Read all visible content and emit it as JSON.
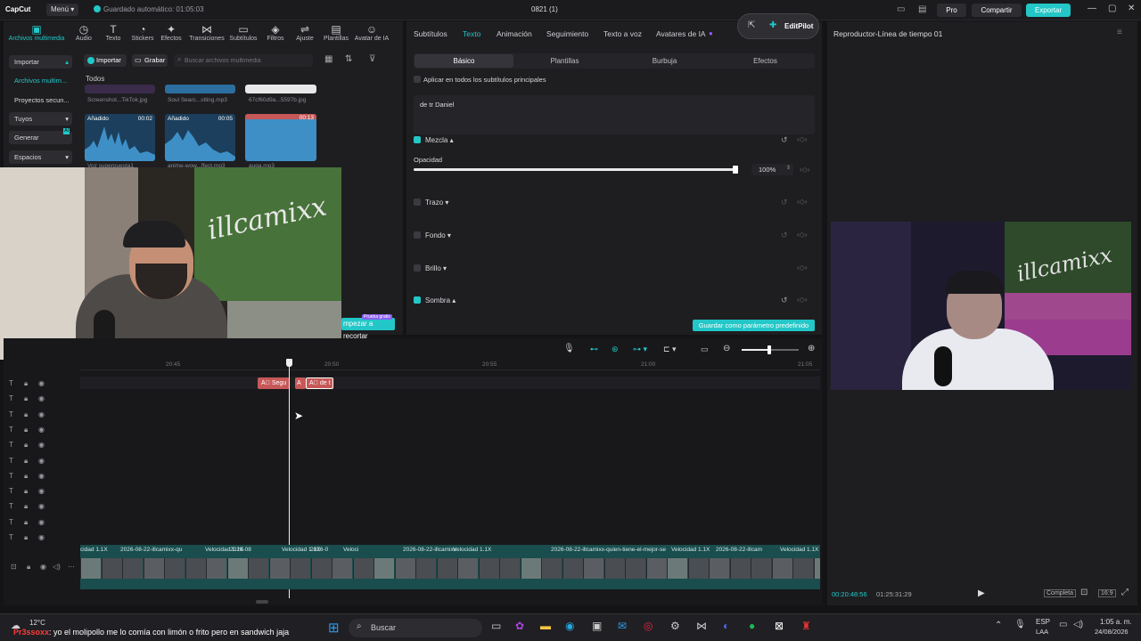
{
  "titlebar": {
    "logo": "CapCut",
    "menu": "Menú",
    "autosave": "Guardado automático: 01:05:03",
    "project": "0821 (1)",
    "pro": "Pro",
    "share": "Compartir",
    "export": "Exportar"
  },
  "toolbar": [
    {
      "label": "Archivos multimedia",
      "glyph": "▣",
      "active": true
    },
    {
      "label": "Audio",
      "glyph": "◷"
    },
    {
      "label": "Texto",
      "glyph": "T"
    },
    {
      "label": "Stickers",
      "glyph": "◔"
    },
    {
      "label": "Efectos",
      "glyph": "✦"
    },
    {
      "label": "Transiciones",
      "glyph": "⋈"
    },
    {
      "label": "Subtítulos",
      "glyph": "▭"
    },
    {
      "label": "Filtros",
      "glyph": "◈"
    },
    {
      "label": "Ajuste",
      "glyph": "⇌"
    },
    {
      "label": "Plantillas",
      "glyph": "▤"
    },
    {
      "label": "Avatar de IA",
      "glyph": "☺"
    }
  ],
  "sidebar": {
    "items": [
      {
        "label": "Importar"
      },
      {
        "label": "Archivos multim..."
      },
      {
        "label": "Proyectos secun..."
      },
      {
        "label": "Tuyos"
      },
      {
        "label": "Generar",
        "badge": "AI"
      },
      {
        "label": "Espacios"
      }
    ]
  },
  "media": {
    "import_label": "Importar",
    "record_label": "Grabar",
    "search_placeholder": "Buscar archivos multimedia",
    "all_label": "Todos",
    "row1": [
      "Screenshot...TikTok.jpg",
      "Soul Searc...stling.mp3",
      "67cf60d9a...5597b.jpg"
    ],
    "row2": [
      {
        "tag": "Añadido",
        "dur": "00:02",
        "name": "Voz superpuesta1"
      },
      {
        "tag": "Añadido",
        "dur": "00:05",
        "name": "anime-wow...ffect.mp3"
      },
      {
        "tag": "",
        "dur": "00:13",
        "name": "auga.mp3"
      }
    ],
    "trim_label": "mpezar a recortar",
    "trim_badge": "Prueba gratis"
  },
  "props": {
    "tabs": [
      "Subtítulos",
      "Texto",
      "Animación",
      "Seguimiento",
      "Texto a voz",
      "Avatares de IA"
    ],
    "editpilot": "EditPilot",
    "subtabs": [
      "Básico",
      "Plantillas",
      "Burbuja",
      "Efectos"
    ],
    "apply_all": "Aplicar en todos los subtítulos principales",
    "text_value": "de tr Daniel",
    "blend": "Mezcla",
    "opacity_label": "Opacidad",
    "opacity_value": "100%",
    "opacity": 1.0,
    "stroke": "Trazo",
    "background": "Fondo",
    "glow": "Brillo",
    "shadow": "Sombra",
    "save_preset": "Guardar como parámetro predefinido"
  },
  "player": {
    "title": "Reproductor-Línea de tiempo 01",
    "current": "00:20:48:56",
    "total": "01:25:31:29",
    "full": "Completa",
    "ratio": "16:9"
  },
  "timeline": {
    "ruler": [
      "20:45",
      "20:50",
      "20:55",
      "21:00",
      "21:05"
    ],
    "clips": [
      "Segu",
      "A",
      "de t"
    ],
    "video_labels": [
      "cidad 1.1X",
      "2026-08-22-illcamixx-qu",
      "Velocidad 1.1X",
      "2026-08",
      "Velocidad 1.1X",
      "2026-0",
      "Veloci",
      "2026-08-22-illcamixx",
      "Velocidad 1.1X",
      "2026-08-22-illcamixx-quien-tiene-el-mejor-se",
      "Velocidad 1.1X",
      "2026-08-22-illcam",
      "Velocidad 1.1X"
    ]
  },
  "webcam": {
    "sign": "illcamixx"
  },
  "taskbar": {
    "temp": "12°C",
    "search": "Buscar",
    "lang": "ESP",
    "lang2": "LAA",
    "time": "1:05 a. m.",
    "date": "24/08/2026"
  },
  "overlay": {
    "user": "Pr3ssoxx",
    "message": ": yo el molipollo me lo comía con limón o frito pero en sandwich jaja"
  },
  "colors": {
    "accent": "#23c7c7",
    "bg": "#141416",
    "panel": "#1e1e21"
  }
}
